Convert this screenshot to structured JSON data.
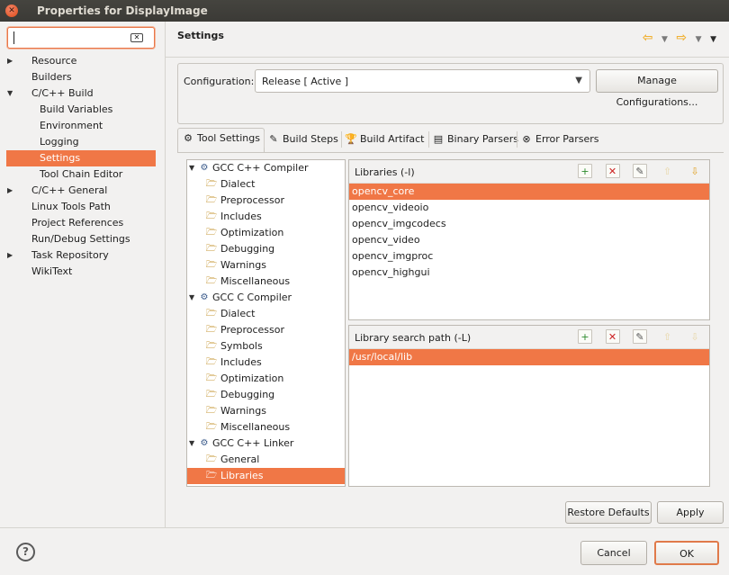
{
  "window": {
    "title": "Properties for DisplayImage"
  },
  "filter": {
    "value": ""
  },
  "sidebar": {
    "items": [
      {
        "label": "Resource",
        "level": 0,
        "twisty": "collapsed",
        "selected": false
      },
      {
        "label": "Builders",
        "level": 0,
        "twisty": "none",
        "selected": false
      },
      {
        "label": "C/C++ Build",
        "level": 0,
        "twisty": "expanded",
        "selected": false
      },
      {
        "label": "Build Variables",
        "level": 1,
        "twisty": "none",
        "selected": false
      },
      {
        "label": "Environment",
        "level": 1,
        "twisty": "none",
        "selected": false
      },
      {
        "label": "Logging",
        "level": 1,
        "twisty": "none",
        "selected": false
      },
      {
        "label": "Settings",
        "level": 1,
        "twisty": "none",
        "selected": true
      },
      {
        "label": "Tool Chain Editor",
        "level": 1,
        "twisty": "none",
        "selected": false
      },
      {
        "label": "C/C++ General",
        "level": 0,
        "twisty": "collapsed",
        "selected": false
      },
      {
        "label": "Linux Tools Path",
        "level": 0,
        "twisty": "none",
        "selected": false
      },
      {
        "label": "Project References",
        "level": 0,
        "twisty": "none",
        "selected": false
      },
      {
        "label": "Run/Debug Settings",
        "level": 0,
        "twisty": "none",
        "selected": false
      },
      {
        "label": "Task Repository",
        "level": 0,
        "twisty": "collapsed",
        "selected": false
      },
      {
        "label": "WikiText",
        "level": 0,
        "twisty": "none",
        "selected": false
      }
    ]
  },
  "page": {
    "title": "Settings"
  },
  "configuration": {
    "label": "Configuration:",
    "value": "Release  [ Active ]",
    "manage_label": "Manage Configurations..."
  },
  "tabs": [
    {
      "label": "Tool Settings",
      "icon": "tool-settings-icon",
      "glyph": "⚙",
      "active": true
    },
    {
      "label": "Build Steps",
      "icon": "build-steps-icon",
      "glyph": "✎",
      "active": false
    },
    {
      "label": "Build Artifact",
      "icon": "build-artifact-icon",
      "glyph": "🏆",
      "active": false
    },
    {
      "label": "Binary Parsers",
      "icon": "binary-parsers-icon",
      "glyph": "▤",
      "active": false
    },
    {
      "label": "Error Parsers",
      "icon": "error-parsers-icon",
      "glyph": "⊗",
      "active": false
    }
  ],
  "tool_tree": [
    {
      "label": "GCC C++ Compiler",
      "type": "tool",
      "expanded": true,
      "selected": false
    },
    {
      "label": "Dialect",
      "type": "option",
      "selected": false
    },
    {
      "label": "Preprocessor",
      "type": "option",
      "selected": false
    },
    {
      "label": "Includes",
      "type": "option",
      "selected": false
    },
    {
      "label": "Optimization",
      "type": "option",
      "selected": false
    },
    {
      "label": "Debugging",
      "type": "option",
      "selected": false
    },
    {
      "label": "Warnings",
      "type": "option",
      "selected": false
    },
    {
      "label": "Miscellaneous",
      "type": "option",
      "selected": false
    },
    {
      "label": "GCC C Compiler",
      "type": "tool",
      "expanded": true,
      "selected": false
    },
    {
      "label": "Dialect",
      "type": "option",
      "selected": false
    },
    {
      "label": "Preprocessor",
      "type": "option",
      "selected": false
    },
    {
      "label": "Symbols",
      "type": "option",
      "selected": false
    },
    {
      "label": "Includes",
      "type": "option",
      "selected": false
    },
    {
      "label": "Optimization",
      "type": "option",
      "selected": false
    },
    {
      "label": "Debugging",
      "type": "option",
      "selected": false
    },
    {
      "label": "Warnings",
      "type": "option",
      "selected": false
    },
    {
      "label": "Miscellaneous",
      "type": "option",
      "selected": false
    },
    {
      "label": "GCC C++ Linker",
      "type": "tool",
      "expanded": true,
      "selected": false
    },
    {
      "label": "General",
      "type": "option",
      "selected": false
    },
    {
      "label": "Libraries",
      "type": "option",
      "selected": true
    }
  ],
  "libraries": {
    "title": "Libraries (-l)",
    "items": [
      "opencv_core",
      "opencv_videoio",
      "opencv_imgcodecs",
      "opencv_video",
      "opencv_imgproc",
      "opencv_highgui"
    ],
    "selected_index": 0
  },
  "library_paths": {
    "title": "Library search path (-L)",
    "items": [
      "/usr/local/lib"
    ],
    "selected_index": 0
  },
  "buttons": {
    "restore_defaults": "Restore Defaults",
    "apply": "Apply",
    "cancel": "Cancel",
    "ok": "OK",
    "help": "?"
  },
  "colors": {
    "selection": "#f07746",
    "titlebar": "#3c3b37",
    "close": "#df4a16"
  }
}
